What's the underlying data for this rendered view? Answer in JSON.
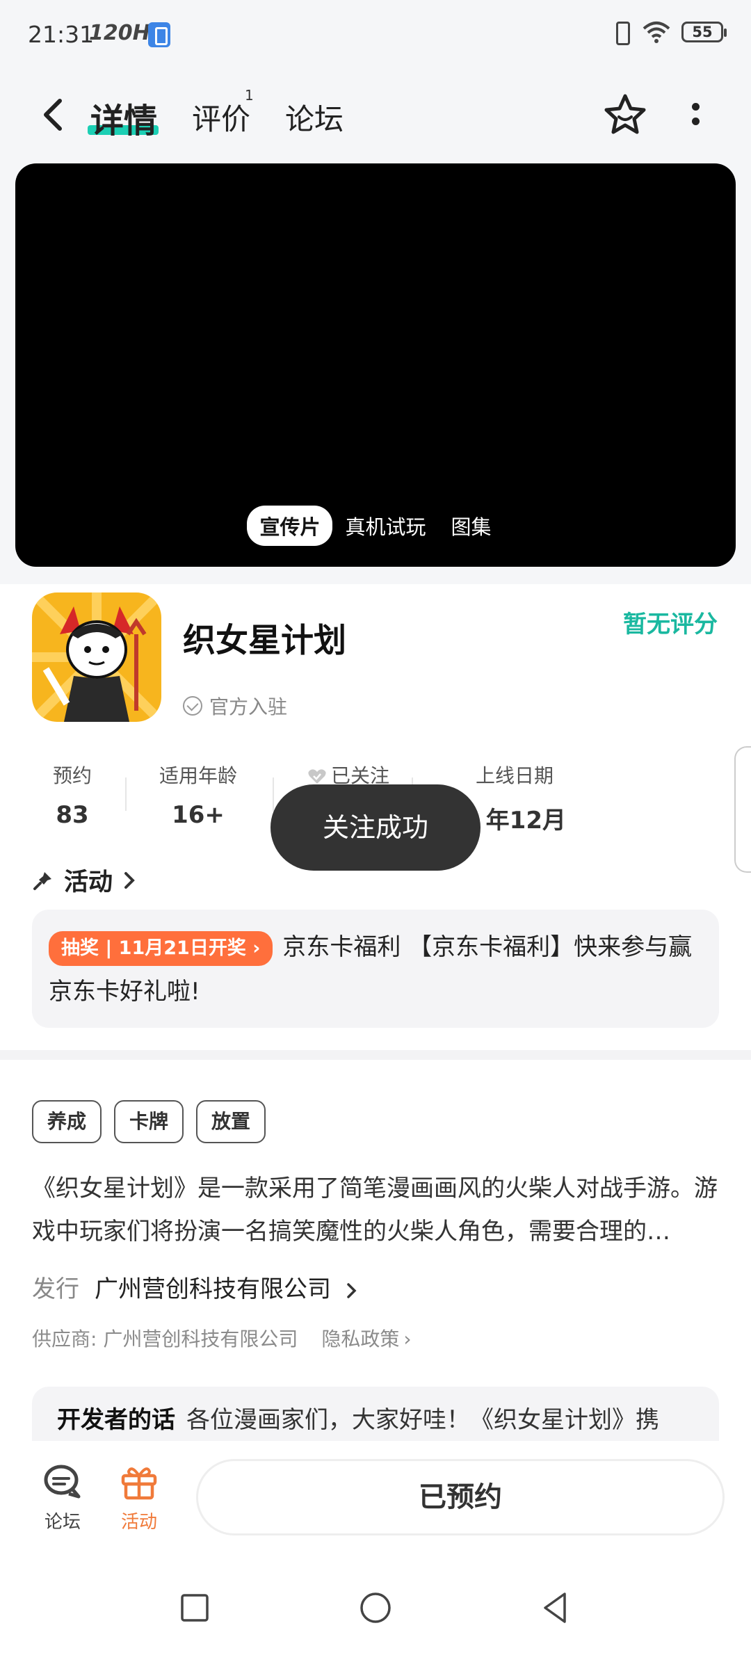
{
  "status_bar": {
    "time": "21:31",
    "refresh_rate": "120Hz",
    "battery": "55"
  },
  "header": {
    "tabs": [
      {
        "label": "详情",
        "active": true
      },
      {
        "label": "评价",
        "badge": "1"
      },
      {
        "label": "论坛"
      }
    ]
  },
  "media": {
    "tabs": [
      {
        "label": "宣传片",
        "active": true
      },
      {
        "label": "真机试玩"
      },
      {
        "label": "图集"
      }
    ]
  },
  "app": {
    "name": "织女星计划",
    "official_label": "官方入驻",
    "rating": "暂无评分"
  },
  "stats": [
    {
      "label": "预约",
      "value": "83"
    },
    {
      "label": "适用年龄",
      "value": "16+"
    },
    {
      "label": "已关注",
      "value": ""
    },
    {
      "label": "上线日期",
      "value": "年12月"
    }
  ],
  "toast": "关注成功",
  "activity": {
    "title": "活动",
    "badge_type": "抽奖",
    "badge_date": "11月21日开奖",
    "text": "京东卡福利 【京东卡福利】快来参与赢京东卡好礼啦!"
  },
  "tags": [
    "养成",
    "卡牌",
    "放置"
  ],
  "description": "《织女星计划》是一款采用了简笔漫画画风的火柴人对战手游。游戏中玩家们将扮演一名搞笑魔性的火柴人角色，需要合理的…",
  "publisher": {
    "label": "发行",
    "name": "广州营创科技有限公司"
  },
  "supplier": {
    "text": "供应商: 广州营创科技有限公司",
    "privacy": "隐私政策"
  },
  "developer_note": {
    "title": "开发者的话",
    "text": "各位漫画家们，大家好哇！《织女星计划》携"
  },
  "bottom_bar": {
    "forum_label": "论坛",
    "activity_label": "活动",
    "reserve_label": "已预约"
  },
  "colors": {
    "accent": "#1ccfb4",
    "rating": "#1ab8a0",
    "activity": "#f07a3a",
    "badge": "#ff6f3c"
  }
}
